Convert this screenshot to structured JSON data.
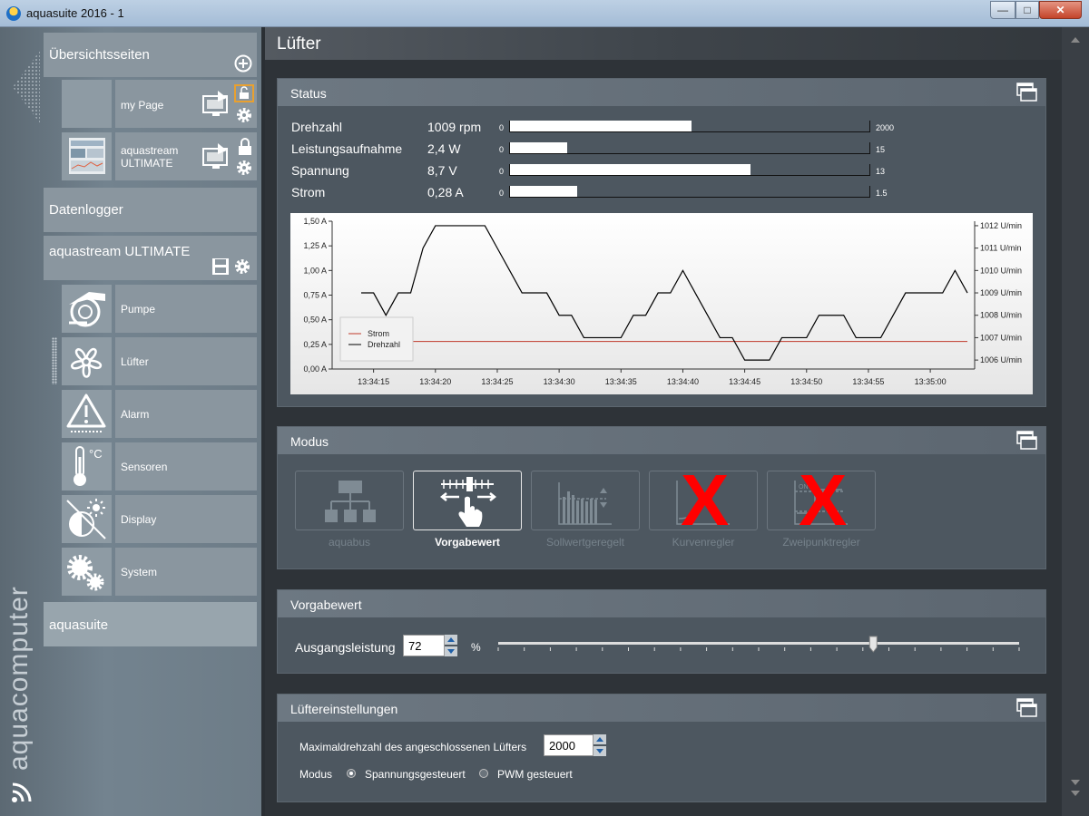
{
  "window": {
    "title": "aquasuite 2016 - 1"
  },
  "sidebar": {
    "overview": "Übersichtsseiten",
    "pages": [
      {
        "label": "my Page"
      },
      {
        "label1": "aquastream",
        "label2": "ULTIMATE"
      }
    ],
    "datalogger": "Datenlogger",
    "device": "aquastream ULTIMATE",
    "items": [
      {
        "label": "Pumpe",
        "icon": "pump-icon"
      },
      {
        "label": "Lüfter",
        "icon": "fan-icon"
      },
      {
        "label": "Alarm",
        "icon": "alarm-icon"
      },
      {
        "label": "Sensoren",
        "icon": "thermometer-icon"
      },
      {
        "label": "Display",
        "icon": "display-icon"
      },
      {
        "label": "System",
        "icon": "gears-icon"
      }
    ],
    "aquasuite": "aquasuite",
    "brand": "aquacomputer"
  },
  "page": {
    "title": "Lüfter"
  },
  "status": {
    "title": "Status",
    "rows": [
      {
        "label": "Drehzahl",
        "value": "1009 rpm",
        "min": "0",
        "max": "2000",
        "fraction": 0.5045
      },
      {
        "label": "Leistungsaufnahme",
        "value": "2,4 W",
        "min": "0",
        "max": "15",
        "fraction": 0.16
      },
      {
        "label": "Spannung",
        "value": "8,7 V",
        "min": "0",
        "max": "13",
        "fraction": 0.669
      },
      {
        "label": "Strom",
        "value": "0,28 A",
        "min": "0",
        "max": "1.5",
        "fraction": 0.187
      }
    ]
  },
  "chart_data": {
    "type": "line",
    "x": [
      "13:34:14",
      "13:34:15",
      "13:34:16",
      "13:34:17",
      "13:34:18",
      "13:34:19",
      "13:34:20",
      "13:34:21",
      "13:34:22",
      "13:34:23",
      "13:34:24",
      "13:34:25",
      "13:34:26",
      "13:34:27",
      "13:34:28",
      "13:34:29",
      "13:34:30",
      "13:34:31",
      "13:34:32",
      "13:34:33",
      "13:34:34",
      "13:34:35",
      "13:34:36",
      "13:34:37",
      "13:34:38",
      "13:34:39",
      "13:34:40",
      "13:34:41",
      "13:34:42",
      "13:34:43",
      "13:34:44",
      "13:34:45",
      "13:34:46",
      "13:34:47",
      "13:34:48",
      "13:34:49",
      "13:34:50",
      "13:34:51",
      "13:34:52",
      "13:34:53",
      "13:34:54",
      "13:34:55",
      "13:34:56",
      "13:34:57",
      "13:34:58",
      "13:34:59",
      "13:35:00",
      "13:35:01",
      "13:35:02",
      "13:35:03"
    ],
    "xticks": [
      "13:34:15",
      "13:34:20",
      "13:34:25",
      "13:34:30",
      "13:34:35",
      "13:34:40",
      "13:34:45",
      "13:34:50",
      "13:34:55",
      "13:35:00"
    ],
    "series": [
      {
        "name": "Strom",
        "axis": "left",
        "color": "#c0392b",
        "values": [
          0.28,
          0.28,
          0.28,
          0.28,
          0.28,
          0.28,
          0.28,
          0.28,
          0.28,
          0.28,
          0.28,
          0.28,
          0.28,
          0.28,
          0.28,
          0.28,
          0.28,
          0.28,
          0.28,
          0.28,
          0.28,
          0.28,
          0.28,
          0.28,
          0.28,
          0.28,
          0.28,
          0.28,
          0.28,
          0.28,
          0.28,
          0.28,
          0.28,
          0.28,
          0.28,
          0.28,
          0.28,
          0.28,
          0.28,
          0.28,
          0.28,
          0.28,
          0.28,
          0.28,
          0.28,
          0.28,
          0.28,
          0.28,
          0.28,
          0.28
        ]
      },
      {
        "name": "Drehzahl",
        "axis": "right",
        "color": "#000000",
        "values": [
          1009,
          1009,
          1008,
          1009,
          1009,
          1011,
          1012,
          1012,
          1012,
          1012,
          1012,
          1011,
          1010,
          1009,
          1009,
          1009,
          1008,
          1008,
          1007,
          1007,
          1007,
          1007,
          1008,
          1008,
          1009,
          1009,
          1010,
          1009,
          1008,
          1007,
          1007,
          1006,
          1006,
          1006,
          1007,
          1007,
          1007,
          1008,
          1008,
          1008,
          1007,
          1007,
          1007,
          1008,
          1009,
          1009,
          1009,
          1009,
          1010,
          1009
        ]
      }
    ],
    "y_left": {
      "ticks": [
        "0,00 A",
        "0,25 A",
        "0,50 A",
        "0,75 A",
        "1,00 A",
        "1,25 A",
        "1,50 A"
      ],
      "range": [
        0,
        1.5
      ]
    },
    "y_right": {
      "ticks": [
        "1006 U/min",
        "1007 U/min",
        "1008 U/min",
        "1009 U/min",
        "1010 U/min",
        "1011 U/min",
        "1012 U/min"
      ],
      "range": [
        1005.6,
        1012.2
      ]
    },
    "legend": "bottom-left"
  },
  "modus": {
    "title": "Modus",
    "modes": [
      {
        "label": "aquabus",
        "state": "disabled"
      },
      {
        "label": "Vorgabewert",
        "state": "active"
      },
      {
        "label": "Sollwertgeregelt",
        "state": "disabled"
      },
      {
        "label": "Kurvenregler",
        "state": "crossed"
      },
      {
        "label": "Zweipunktregler",
        "state": "crossed"
      }
    ]
  },
  "vorgabe": {
    "title": "Vorgabewert",
    "label": "Ausgangsleistung",
    "value": "72",
    "unit": "%",
    "slider_fraction": 0.72
  },
  "fan_settings": {
    "title": "Lüftereinstellungen",
    "max_label": "Maximaldrehzahl des angeschlossenen Lüfters",
    "max_value": "2000",
    "mode_label": "Modus",
    "options": [
      {
        "label": "Spannungsgesteuert",
        "selected": true
      },
      {
        "label": "PWM gesteuert",
        "selected": false
      }
    ]
  },
  "colors": {
    "accent_orange": "#e8a030",
    "crossed": "#ff0000"
  }
}
